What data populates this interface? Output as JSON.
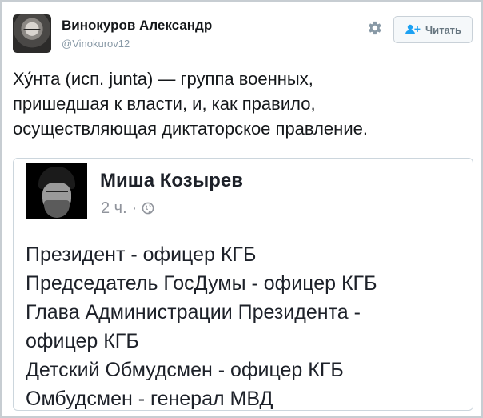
{
  "tweet": {
    "user_name": "Винокуров Александр",
    "user_handle": "@Vinokurov12",
    "follow_label": "Читать",
    "text": "Ху́нта (исп. junta) — группа военных,\nпришедшая к власти, и, как правило,\nосуществляющая диктаторское правление."
  },
  "embedded_post": {
    "author": "Миша Козырев",
    "time": "2 ч.",
    "separator": "·",
    "privacy_icon": "globe-icon",
    "lines": [
      "Президент - офицер КГБ",
      "Председатель ГосДумы - офицер КГБ",
      "Глава Администрации Президента -",
      "офицер КГБ",
      "Детский Обмудсмен - офицер КГБ",
      "Омбудсмен - генерал МВД"
    ]
  },
  "icons": {
    "settings": "gear-icon",
    "follow": "add-user-icon"
  },
  "colors": {
    "handle": "#8899a6",
    "meta": "#90949c",
    "follow_text": "#66757f"
  }
}
